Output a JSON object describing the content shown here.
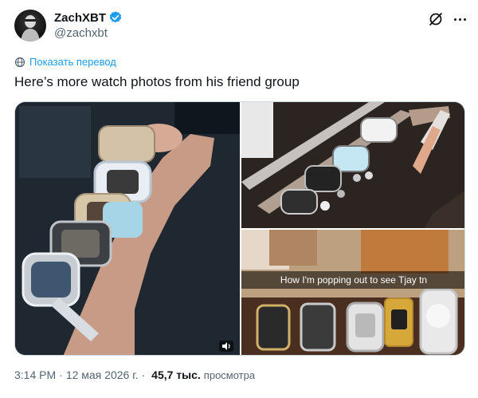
{
  "author": {
    "display_name": "ZachXBT",
    "handle": "@zachxbt"
  },
  "translate_label": "Показать перевод",
  "text": "Here’s more watch photos from his friend group",
  "media": {
    "caption": "How I'm popping out to see Tjay tn"
  },
  "meta": {
    "time": "3:14 PM",
    "separator": "·",
    "date": "12 мая 2026 г.",
    "views_count": "45,7 тыс.",
    "views_label": "просмотра"
  },
  "icons": {
    "verified": "verified-badge-icon",
    "grok": "grok-icon",
    "more": "more-icon",
    "translate": "globe-icon",
    "sound": "speaker-icon"
  },
  "colors": {
    "accent": "#1d9bf0",
    "text": "#0f1419",
    "secondary": "#536471"
  }
}
